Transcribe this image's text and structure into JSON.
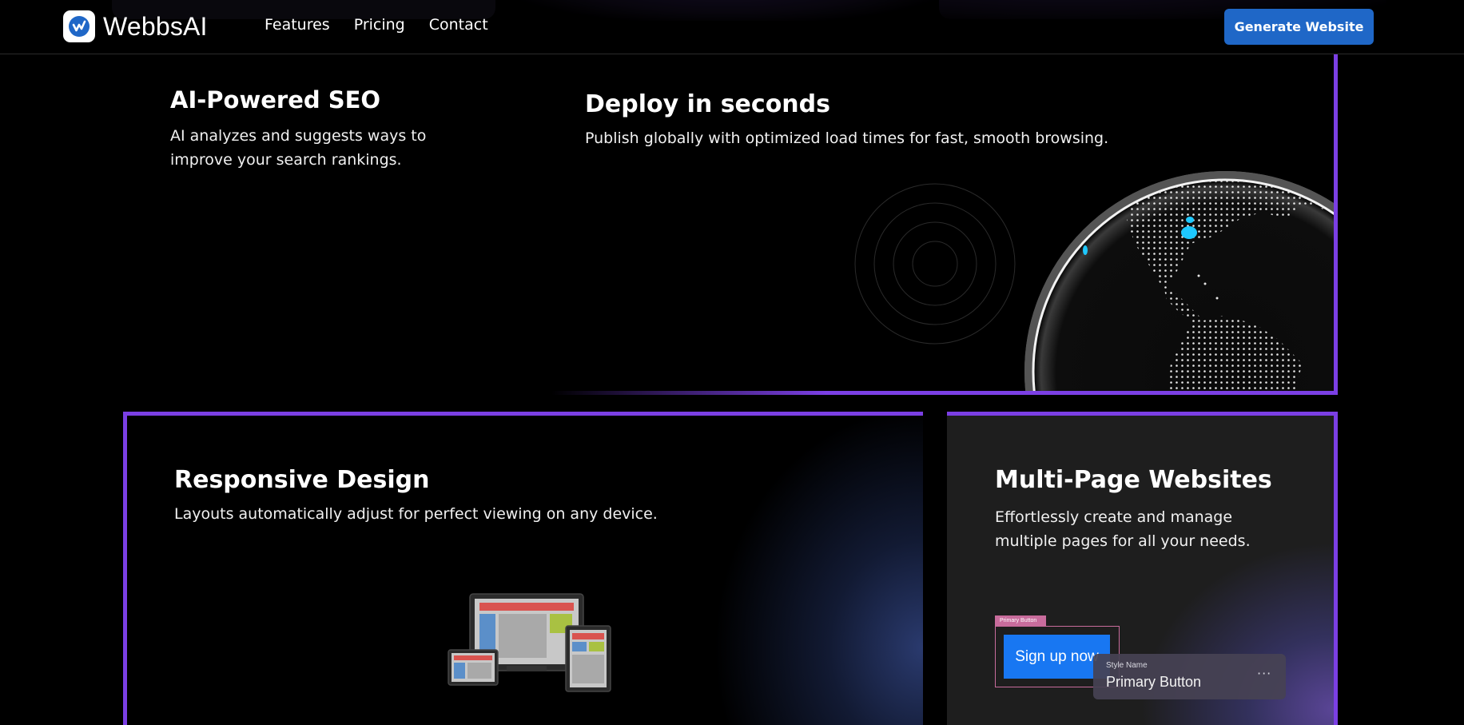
{
  "nav": {
    "brand": "WebbsAI",
    "links": [
      "Features",
      "Pricing",
      "Contact"
    ],
    "cta": "Generate Website"
  },
  "cards": {
    "seo": {
      "title": "AI-Powered SEO",
      "desc": "AI analyzes and suggests ways to improve your search rankings."
    },
    "deploy": {
      "title": "Deploy in seconds",
      "desc": "Publish globally with optimized load times for fast, smooth browsing."
    },
    "responsive": {
      "title": "Responsive Design",
      "desc": "Layouts automatically adjust for perfect viewing on any device."
    },
    "multipage": {
      "title": "Multi-Page Websites",
      "desc": "Effortlessly create and manage multiple pages for all your needs.",
      "demo": {
        "tag": "Primary Button",
        "button": "Sign up now",
        "style_label": "Style Name",
        "style_value": "Primary Button",
        "more": "···"
      }
    }
  },
  "colors": {
    "accent_border": "#7b3fe4",
    "cta": "#1f67c7",
    "signup": "#1877f2",
    "globe_highlight": "#1ec8ff"
  }
}
